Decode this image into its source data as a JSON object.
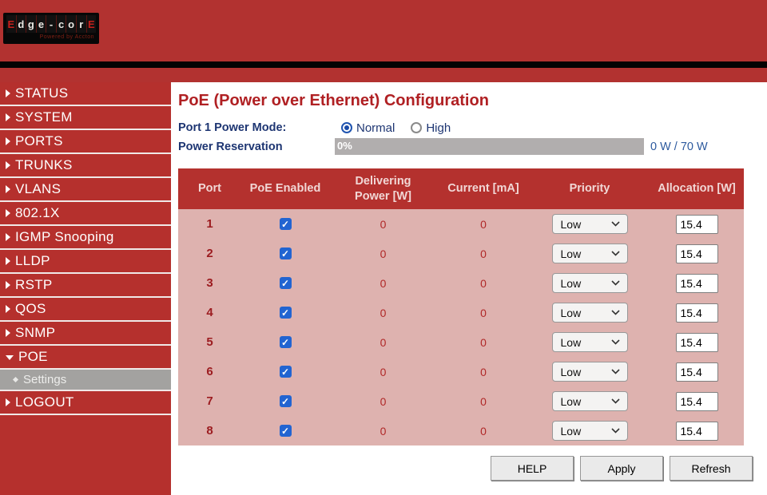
{
  "header": {
    "logo": {
      "letters": [
        "E",
        "d",
        "g",
        "e",
        "-",
        "c",
        "o",
        "r",
        "E"
      ],
      "tagline": "Powered by Accton"
    }
  },
  "sidebar": {
    "items": [
      {
        "label": "STATUS"
      },
      {
        "label": "SYSTEM"
      },
      {
        "label": "PORTS"
      },
      {
        "label": "TRUNKS"
      },
      {
        "label": "VLANS"
      },
      {
        "label": "802.1X"
      },
      {
        "label": "IGMP Snooping"
      },
      {
        "label": "LLDP"
      },
      {
        "label": "RSTP"
      },
      {
        "label": "QOS"
      },
      {
        "label": "SNMP"
      },
      {
        "label": "POE",
        "expanded": true
      },
      {
        "label": "Settings",
        "sub": true,
        "active": true
      },
      {
        "label": "LOGOUT"
      }
    ]
  },
  "main": {
    "title": "PoE (Power over Ethernet) Configuration",
    "power_mode": {
      "label": "Port 1 Power Mode:",
      "options": [
        "Normal",
        "High"
      ],
      "selected": "Normal"
    },
    "reservation": {
      "label": "Power Reservation",
      "percent": 0,
      "percent_label": "0%",
      "usage_label": "0 W / 70 W"
    },
    "table": {
      "headers": [
        "Port",
        "PoE Enabled",
        "Delivering Power [W]",
        "Current [mA]",
        "Priority",
        "Allocation [W]"
      ],
      "rows": [
        {
          "port": "1",
          "enabled": true,
          "delivering": "0",
          "current": "0",
          "priority": "Low",
          "allocation": "15.4"
        },
        {
          "port": "2",
          "enabled": true,
          "delivering": "0",
          "current": "0",
          "priority": "Low",
          "allocation": "15.4"
        },
        {
          "port": "3",
          "enabled": true,
          "delivering": "0",
          "current": "0",
          "priority": "Low",
          "allocation": "15.4"
        },
        {
          "port": "4",
          "enabled": true,
          "delivering": "0",
          "current": "0",
          "priority": "Low",
          "allocation": "15.4"
        },
        {
          "port": "5",
          "enabled": true,
          "delivering": "0",
          "current": "0",
          "priority": "Low",
          "allocation": "15.4"
        },
        {
          "port": "6",
          "enabled": true,
          "delivering": "0",
          "current": "0",
          "priority": "Low",
          "allocation": "15.4"
        },
        {
          "port": "7",
          "enabled": true,
          "delivering": "0",
          "current": "0",
          "priority": "Low",
          "allocation": "15.4"
        },
        {
          "port": "8",
          "enabled": true,
          "delivering": "0",
          "current": "0",
          "priority": "Low",
          "allocation": "15.4"
        }
      ],
      "checkmark": "✓"
    },
    "buttons": {
      "help": "HELP",
      "apply": "Apply",
      "refresh": "Refresh"
    }
  },
  "colors": {
    "brand_red": "#b23230",
    "table_header_red": "#b4312e",
    "table_body_pink": "#deb2af",
    "label_navy": "#1d3572",
    "checkbox_blue": "#2264d1",
    "sub_item_gray": "#a3a2a0"
  }
}
